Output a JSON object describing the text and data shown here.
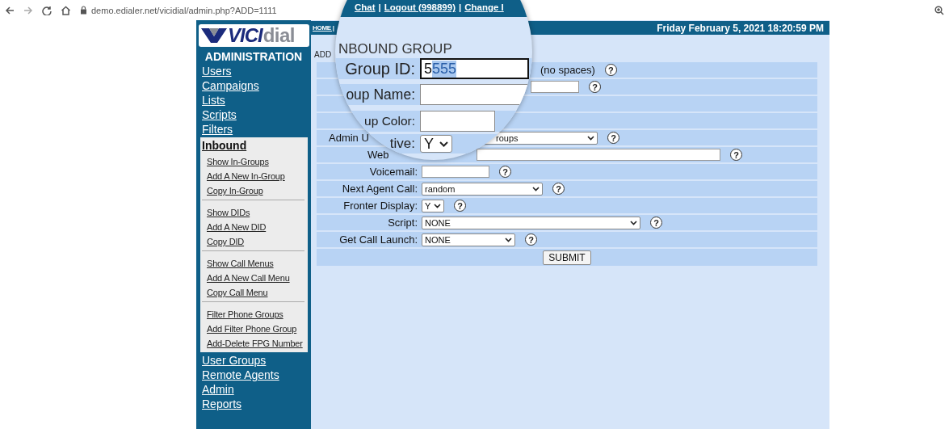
{
  "browser": {
    "url": "demo.edialer.net/vicidial/admin.php?ADD=1111"
  },
  "sidebar": {
    "logo": {
      "part_1": "VICI",
      "part_2": "dial"
    },
    "heading": "ADMINISTRATION",
    "items": [
      {
        "label": "Users",
        "expanded": false
      },
      {
        "label": "Campaigns",
        "expanded": false
      },
      {
        "label": "Lists",
        "expanded": false
      },
      {
        "label": "Scripts",
        "expanded": false
      },
      {
        "label": "Filters",
        "expanded": false
      },
      {
        "label": "Inbound",
        "expanded": true,
        "sections": [
          [
            "Show In-Groups",
            "Add A New In-Group",
            "Copy In-Group"
          ],
          [
            "Show DIDs",
            "Add A New DID",
            "Copy DID"
          ],
          [
            "Show Call Menus",
            "Add A New Call Menu",
            "Copy Call Menu"
          ],
          [
            "Filter Phone Groups",
            "Add Filter Phone Group",
            "Add-Delete FPG Number"
          ]
        ]
      },
      {
        "label": "User Groups",
        "expanded": false
      },
      {
        "label": "Remote Agents",
        "expanded": false
      },
      {
        "label": "Admin",
        "expanded": false
      },
      {
        "label": "Reports",
        "expanded": false
      }
    ]
  },
  "top_bar": {
    "home_link": "HOME |",
    "date": "Friday February 5, 2021 18:20:59 PM"
  },
  "form": {
    "title_visible": "ADD",
    "rows": [
      {
        "kind": "none",
        "note": "(no spaces)",
        "help": "?"
      },
      {
        "kind": "text",
        "help": "?"
      },
      {
        "kind": "none"
      },
      {
        "kind": "none"
      },
      {
        "kind": "select",
        "label": "Admin U",
        "label_cut": true,
        "value": "roups",
        "value_cut": true,
        "help": "?"
      },
      {
        "kind": "text",
        "label": "Web",
        "label_cut": true,
        "help": "?"
      },
      {
        "kind": "text",
        "label": "Voicemail:",
        "help": "?"
      },
      {
        "kind": "select",
        "label": "Next Agent Call:",
        "value": "random",
        "help": "?"
      },
      {
        "kind": "select",
        "label": "Fronter Display:",
        "value": "Y",
        "help": "?"
      },
      {
        "kind": "select",
        "label": "Script:",
        "value": "NONE",
        "help": "?"
      },
      {
        "kind": "select",
        "label": "Get Call Launch:",
        "value": "NONE",
        "help": "?"
      },
      {
        "kind": "button",
        "label": "SUBMIT"
      }
    ]
  },
  "magnifier": {
    "links": [
      "Chat",
      "Logout (998899)",
      "Change I"
    ],
    "separator": "|",
    "title": "NBOUND GROUP",
    "rows": [
      {
        "kind": "text",
        "label": "Group ID:",
        "text_before": "5",
        "text_selected": "555",
        "focused": true
      },
      {
        "kind": "text",
        "label": "oup Name:",
        "focused": false
      },
      {
        "kind": "text",
        "label": "up Color:",
        "focused": false
      },
      {
        "kind": "select",
        "label": "tive:",
        "value": "Y"
      }
    ]
  }
}
